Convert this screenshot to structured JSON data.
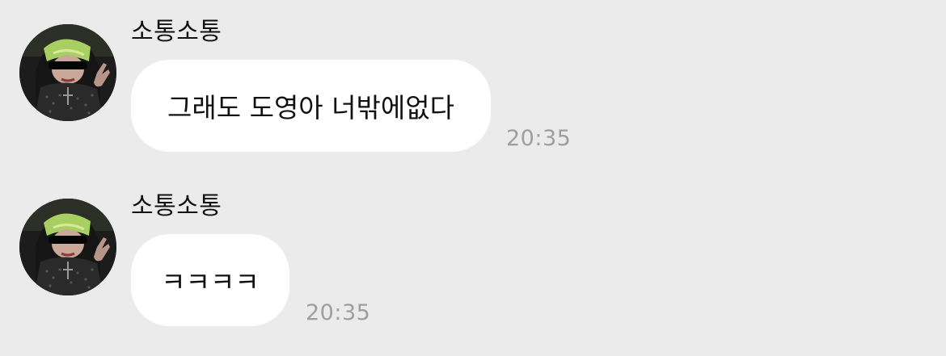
{
  "messages": [
    {
      "sender": "소통소통",
      "avatar": "profile-photo",
      "text": "그래도 도영아 너밖에없다",
      "time": "20:35"
    },
    {
      "sender": "소통소통",
      "avatar": "profile-photo",
      "text": "ㅋㅋㅋㅋ",
      "time": "20:35"
    }
  ],
  "colors": {
    "background": "#ebebeb",
    "bubble": "#ffffff",
    "timestamp": "#9e9e9e"
  }
}
